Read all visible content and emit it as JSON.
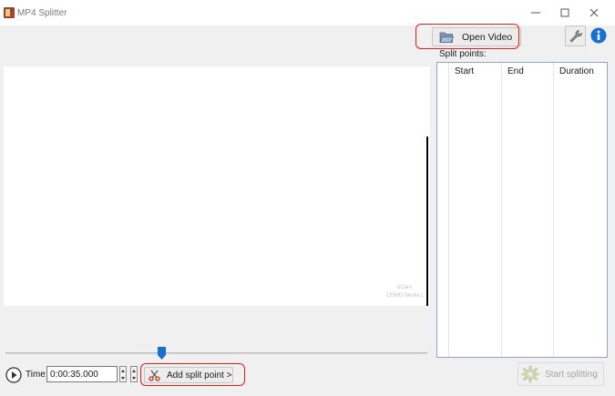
{
  "window": {
    "title": "MP4 Splitter",
    "controls": [
      "minimize-icon",
      "maximize-icon",
      "close-icon"
    ]
  },
  "toolbar": {
    "open_video_label": "Open Video",
    "open_video_icon": "folder-open-icon",
    "settings_icon": "wrench-icon",
    "info_icon": "info-icon"
  },
  "split_points": {
    "label": "Split points:",
    "columns": [
      "Start",
      "End",
      "Duration"
    ],
    "rows": []
  },
  "player": {
    "watermark_logo": "oCam",
    "watermark_text": "OSMO Media |",
    "timeline_position_fraction": 0.37
  },
  "controls": {
    "play_icon": "play-icon",
    "time_label": "Time:",
    "time_value": "0:00:35.000",
    "add_split_label": "Add split point >",
    "add_split_icon": "scissors-icon",
    "start_splitting_label": "Start splitting",
    "start_splitting_icon": "gear-icon"
  },
  "colors": {
    "highlight": "#e41b17",
    "info_blue": "#1a6fd0",
    "thumb_blue": "#1a6fd0",
    "table_border": "#8ea6c4"
  }
}
